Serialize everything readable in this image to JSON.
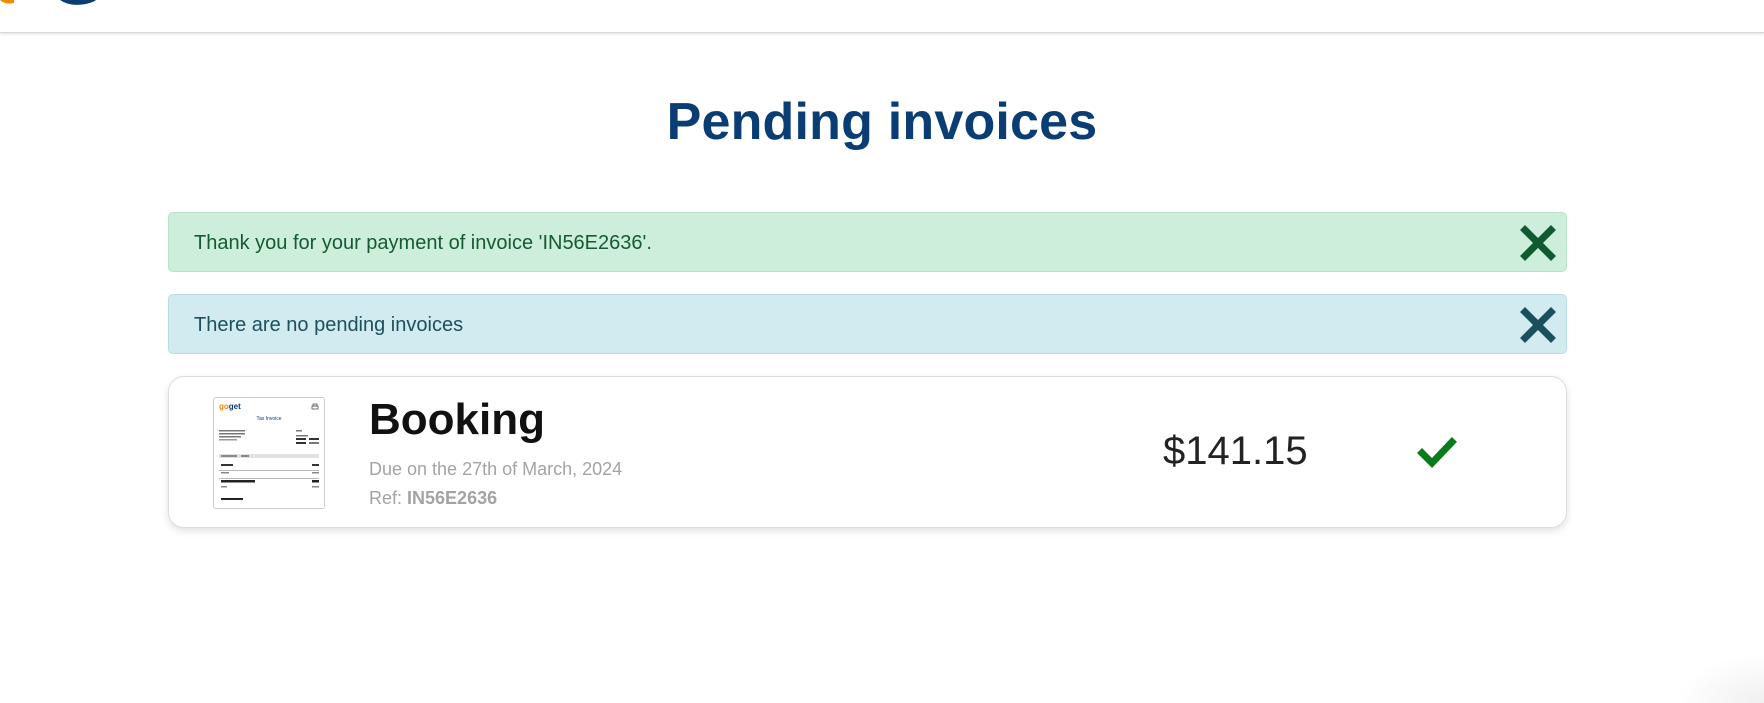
{
  "page": {
    "title": "Pending invoices"
  },
  "alerts": {
    "success": {
      "message": "Thank you for your payment of invoice 'IN56E2636'.",
      "color": "#cdeedb",
      "close_icon": "close-icon"
    },
    "info": {
      "message": "There are no pending invoices",
      "color": "#d1ebf0",
      "close_icon": "close-icon"
    }
  },
  "invoice": {
    "title": "Booking",
    "due": "Due on the 27th of March, 2024",
    "ref_label": "Ref:",
    "ref_value": "IN56E2636",
    "amount": "$141.15",
    "status_icon": "checkmark-icon",
    "status_color": "#0a7a1a",
    "thumbnail": {
      "logo_go": "go",
      "logo_get": "get",
      "title": "Tax Invoice"
    }
  },
  "colors": {
    "title": "#0a3d73",
    "brand_orange": "#f08a00"
  }
}
